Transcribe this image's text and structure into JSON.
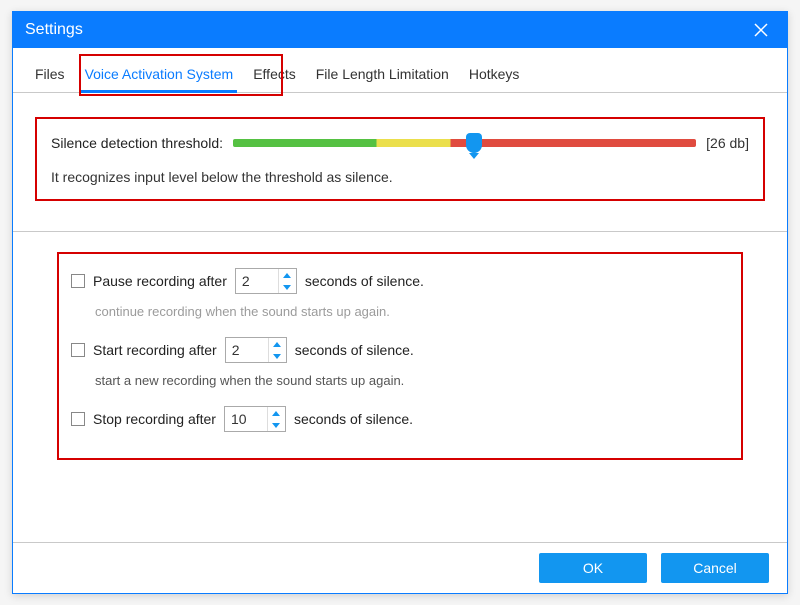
{
  "window": {
    "title": "Settings"
  },
  "tabs": {
    "files": "Files",
    "voice": "Voice Activation System",
    "effects": "Effects",
    "filelen": "File Length Limitation",
    "hotkeys": "Hotkeys"
  },
  "threshold": {
    "label": "Silence detection threshold:",
    "value_display": "[26 db]",
    "slider_percent": 52,
    "description": "It recognizes input level below the threshold as silence."
  },
  "options": {
    "pause": {
      "prefix": "Pause recording after",
      "value": "2",
      "suffix": "seconds of silence.",
      "desc": "continue recording when the sound starts up again."
    },
    "start": {
      "prefix": "Start recording after",
      "value": "2",
      "suffix": "seconds of silence.",
      "desc": "start a new recording when the sound starts up again."
    },
    "stop": {
      "prefix": "Stop recording after",
      "value": "10",
      "suffix": "seconds of silence."
    }
  },
  "buttons": {
    "ok": "OK",
    "cancel": "Cancel"
  }
}
